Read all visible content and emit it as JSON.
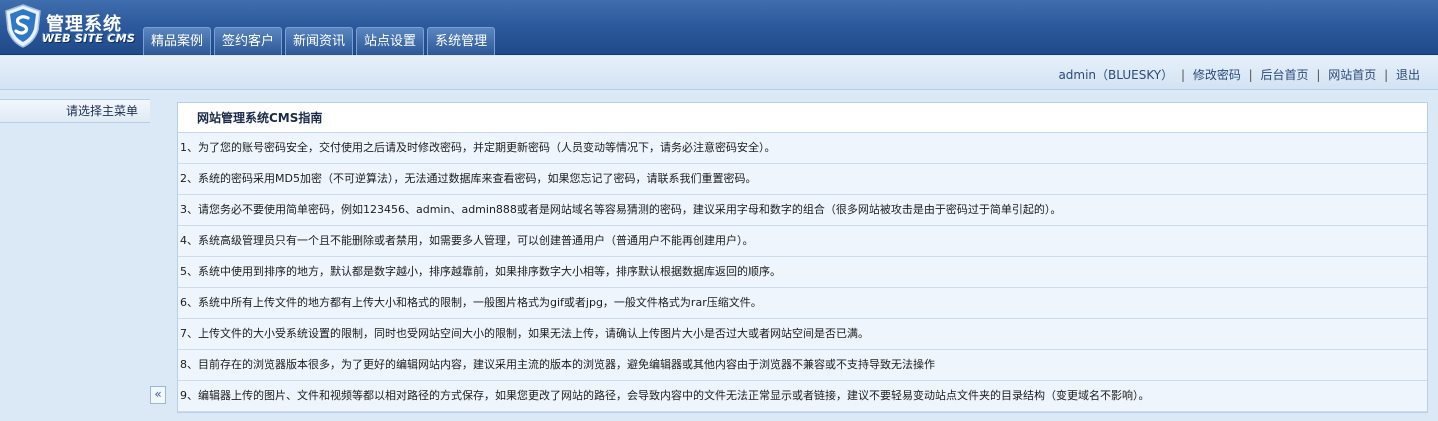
{
  "app": {
    "title": "管理系统",
    "subtitle": "WEB SITE CMS"
  },
  "nav": {
    "tabs": [
      {
        "label": "精品案例"
      },
      {
        "label": "签约客户"
      },
      {
        "label": "新闻资讯"
      },
      {
        "label": "站点设置"
      },
      {
        "label": "系统管理"
      }
    ]
  },
  "userbar": {
    "user": "admin（BLUESKY）",
    "change_password": "修改密码",
    "admin_home": "后台首页",
    "site_home": "网站首页",
    "logout": "退出",
    "separator": "|"
  },
  "sidebar": {
    "heading": "请选择主菜单",
    "collapse_label": "«"
  },
  "main": {
    "title": "网站管理系统CMS指南",
    "tips": [
      "1、为了您的账号密码安全，交付使用之后请及时修改密码，并定期更新密码（人员变动等情况下，请务必注意密码安全）。",
      "2、系统的密码采用MD5加密（不可逆算法），无法通过数据库来查看密码，如果您忘记了密码，请联系我们重置密码。",
      "3、请您务必不要使用简单密码，例如123456、admin、admin888或者是网站域名等容易猜测的密码，建议采用字母和数字的组合（很多网站被攻击是由于密码过于简单引起的）。",
      "4、系统高级管理员只有一个且不能删除或者禁用，如需要多人管理，可以创建普通用户（普通用户不能再创建用户）。",
      "5、系统中使用到排序的地方，默认都是数字越小，排序越靠前，如果排序数字大小相等，排序默认根据数据库返回的顺序。",
      "6、系统中所有上传文件的地方都有上传大小和格式的限制，一般图片格式为gif或者jpg，一般文件格式为rar压缩文件。",
      "7、上传文件的大小受系统设置的限制，同时也受网站空间大小的限制，如果无法上传，请确认上传图片大小是否过大或者网站空间是否已满。",
      "8、目前存在的浏览器版本很多，为了更好的编辑网站内容，建议采用主流的版本的浏览器，避免编辑器或其他内容由于浏览器不兼容或不支持导致无法操作",
      "9、编辑器上传的图片、文件和视频等都以相对路径的方式保存，如果您更改了网站的路径，会导致内容中的文件无法正常显示或者链接，建议不要轻易变动站点文件夹的目录结构（变更域名不影响）。"
    ]
  },
  "colors": {
    "header_blue": "#2d5a9c",
    "link_blue": "#2b4a78",
    "row_bg": "#eef5fc"
  }
}
